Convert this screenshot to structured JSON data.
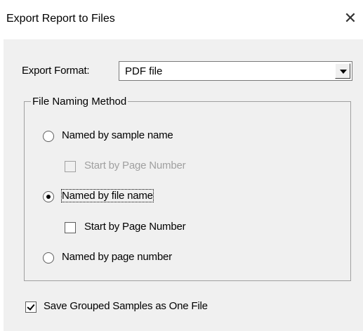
{
  "dialog": {
    "title": "Export Report to Files",
    "close_glyph": "✕"
  },
  "export_format": {
    "label": "Export Format:",
    "selected": "PDF file"
  },
  "file_naming": {
    "group_label": "File Naming Method",
    "options": [
      {
        "label": "Named by sample name",
        "checked": false,
        "sub_checkbox": {
          "label": "Start by Page Number",
          "checked": false,
          "enabled": false
        }
      },
      {
        "label": "Named by file name",
        "checked": true,
        "sub_checkbox": {
          "label": "Start by Page Number",
          "checked": false,
          "enabled": true
        }
      },
      {
        "label": "Named by page number",
        "checked": false
      }
    ]
  },
  "save_grouped": {
    "label": "Save Grouped Samples as One File",
    "checked": true
  }
}
